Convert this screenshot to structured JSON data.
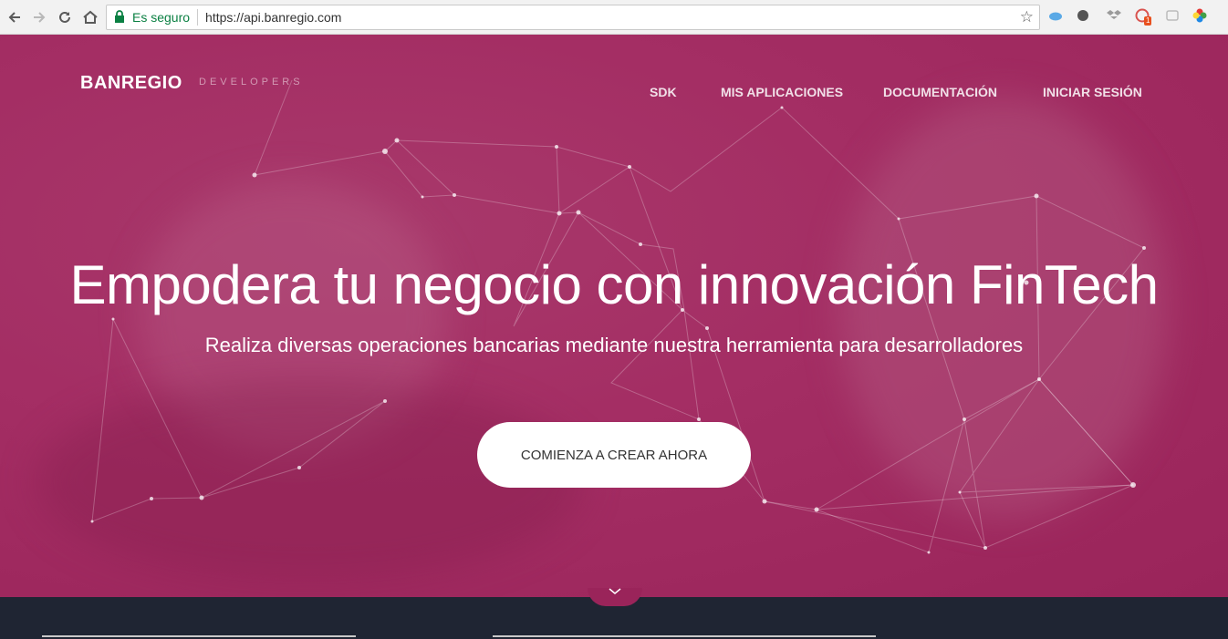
{
  "browser": {
    "secure_label": "Es seguro",
    "url": "https://api.banregio.com",
    "extension_badge": "1"
  },
  "site": {
    "logo": "BANREGIO",
    "logo_sub": "DEVELOPERS",
    "nav": [
      "SDK",
      "MIS APLICACIONES",
      "DOCUMENTACIÓN",
      "INICIAR SESIÓN"
    ]
  },
  "hero": {
    "title": "Empodera tu negocio con innovación FinTech",
    "subtitle": "Realiza diversas operaciones bancarias mediante nuestra herramienta para desarrolladores",
    "cta": "COMIENZA A CREAR AHORA"
  },
  "colors": {
    "hero_bg": "#a42e64",
    "footer_bg": "#1f2533"
  },
  "icons": [
    "back-icon",
    "forward-icon",
    "reload-icon",
    "home-icon",
    "lock-icon",
    "star-icon",
    "chevron-down-icon"
  ]
}
